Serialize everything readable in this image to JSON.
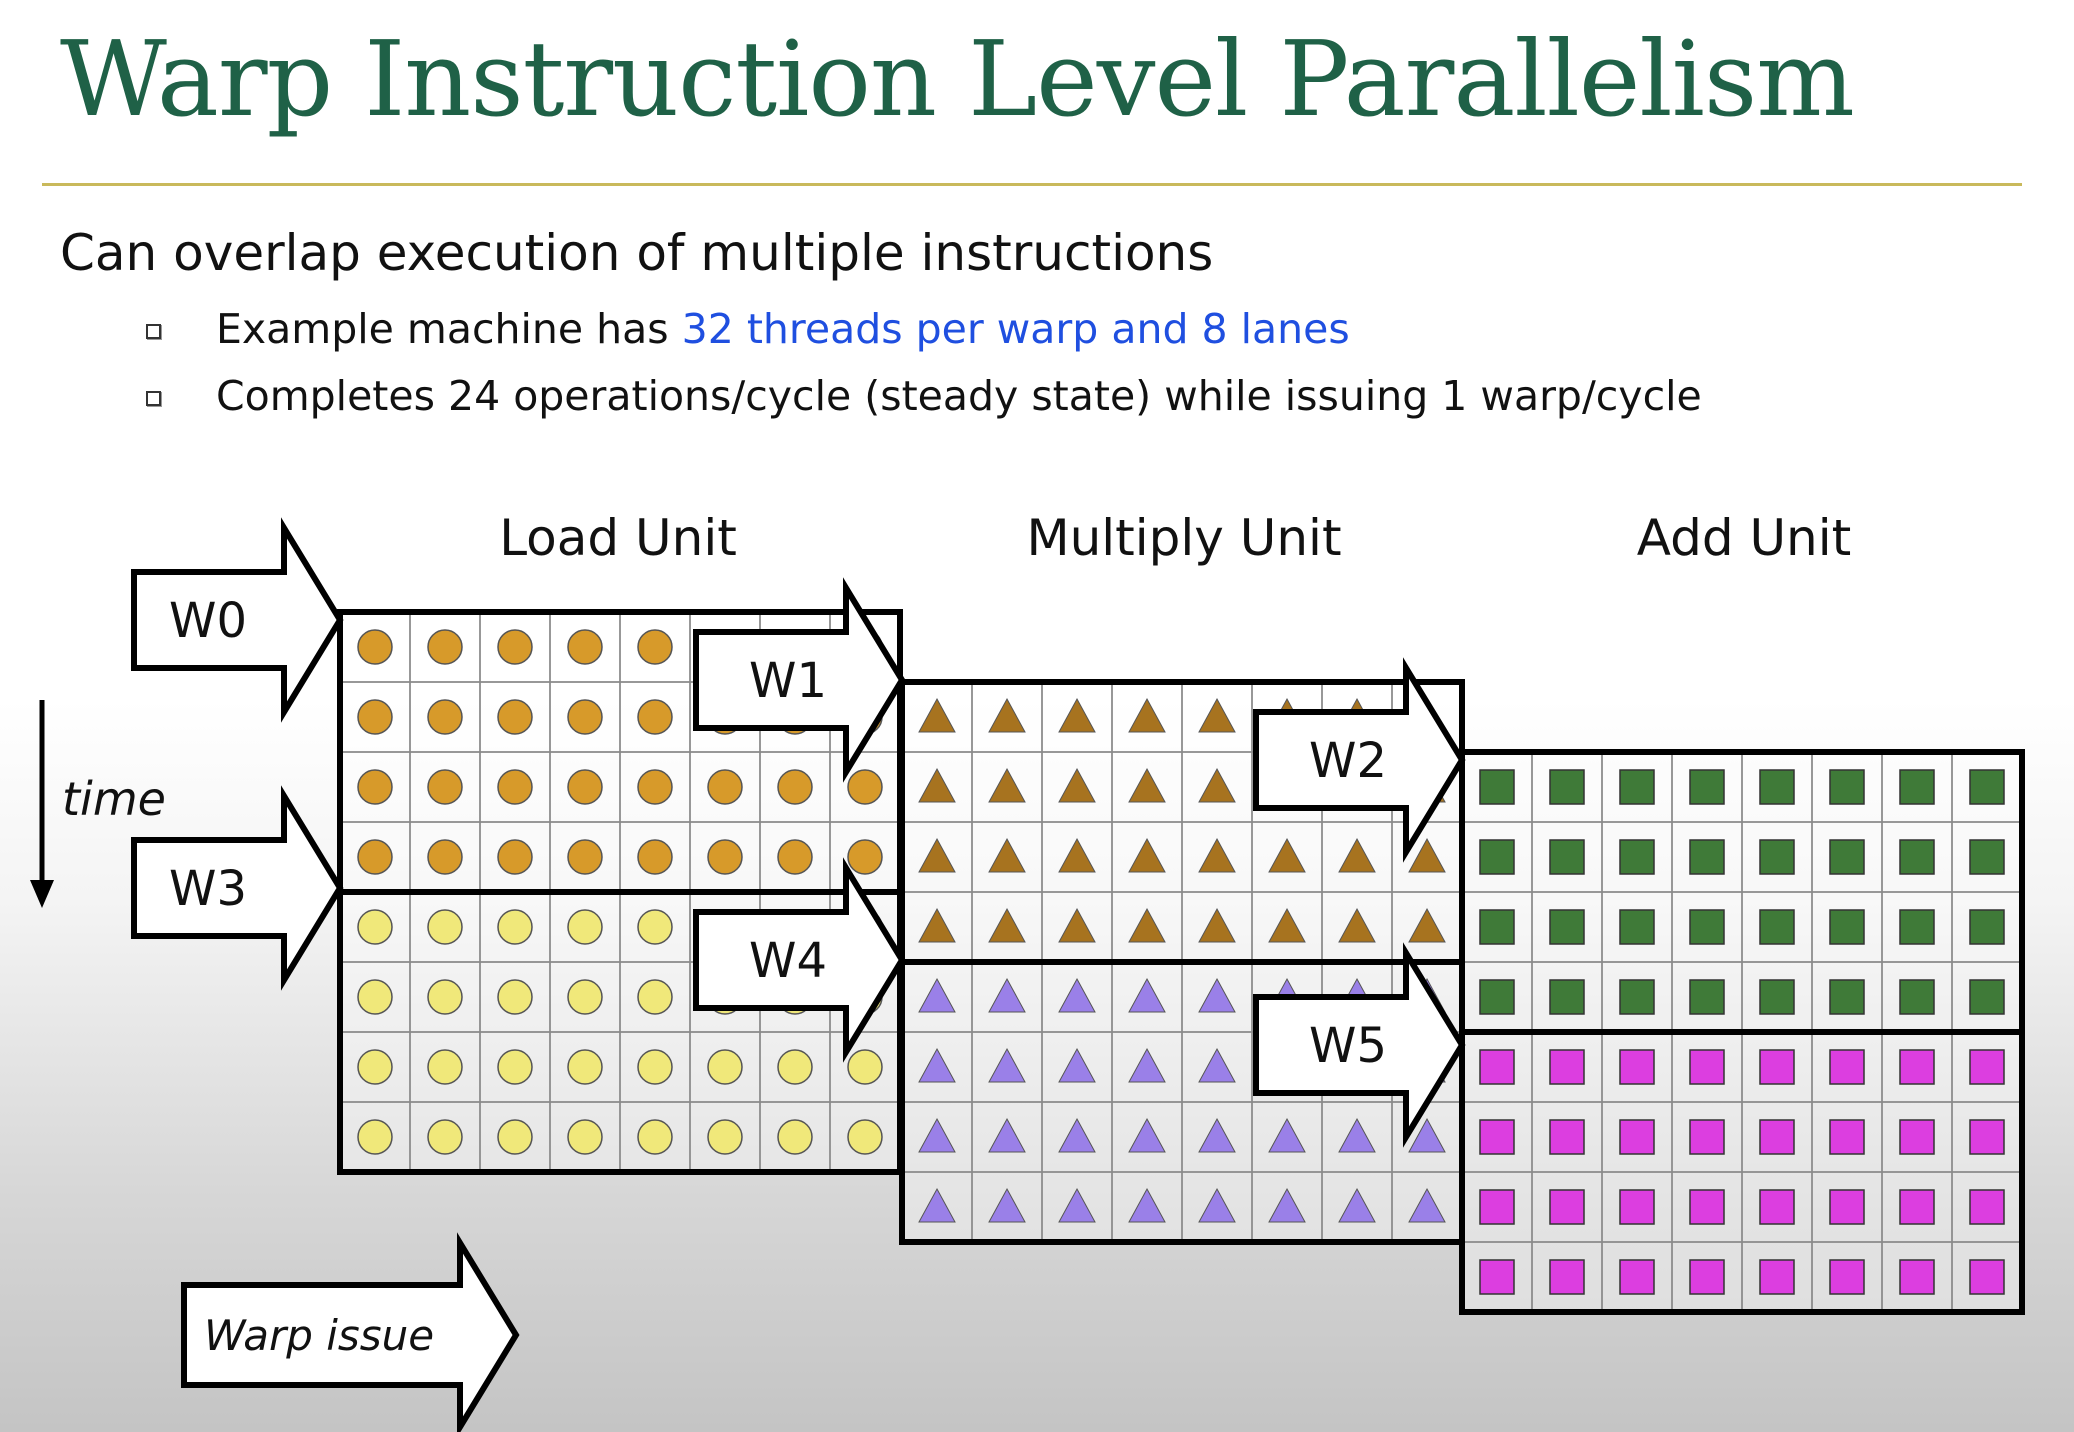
{
  "title": "Warp Instruction Level Parallelism",
  "subtitle": "Can overlap execution of multiple instructions",
  "bullets": [
    {
      "pre": "Example machine has ",
      "highlight": "32 threads per warp and 8 lanes",
      "post": ""
    },
    {
      "pre": "Completes 24 operations/cycle (steady state) while issuing 1 warp/cycle",
      "highlight": "",
      "post": ""
    }
  ],
  "colors": {
    "title": "#1f6147",
    "rule": "#c9b95b",
    "highlight": "#1f4fe0",
    "load_warp0": "#d79a2a",
    "load_warp3": "#f0e87a",
    "mul_warp1": "#a7731f",
    "mul_warp4": "#9a80e8",
    "add_warp2": "#3f7a38",
    "add_warp5": "#dc3ee0"
  },
  "diagram": {
    "units": [
      {
        "label": "Load Unit",
        "shape": "circle",
        "top_color": "load_warp0",
        "bottom_color": "load_warp3"
      },
      {
        "label": "Multiply Unit",
        "shape": "triangle",
        "top_color": "mul_warp1",
        "bottom_color": "mul_warp4"
      },
      {
        "label": "Add Unit",
        "shape": "square",
        "top_color": "add_warp2",
        "bottom_color": "add_warp5"
      }
    ],
    "lanes": 8,
    "rows_per_warp": 4,
    "warps": [
      "W0",
      "W1",
      "W2",
      "W3",
      "W4",
      "W5"
    ],
    "time_label": "time",
    "warp_issue_label": "Warp issue"
  }
}
